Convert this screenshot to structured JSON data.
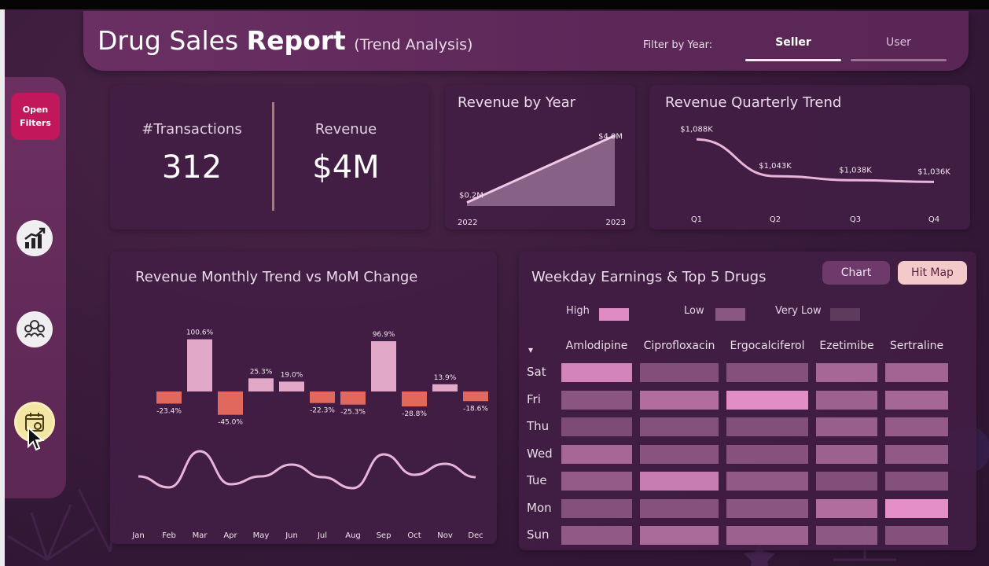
{
  "header": {
    "title_main": "Drug Sales ",
    "title_bold": "Report",
    "title_sub": "(Trend Analysis)",
    "filter_label": "Filter by Year:",
    "tabs": [
      {
        "label": "Seller",
        "active": true
      },
      {
        "label": "User",
        "active": false
      }
    ]
  },
  "sidebar": {
    "open_filters_line1": "Open",
    "open_filters_line2": "Filters",
    "icons": [
      "growth-chart-icon",
      "users-group-icon",
      "calendar-icon"
    ],
    "accent": "#c2185b"
  },
  "kpis": [
    {
      "label": "#Transactions",
      "value": "312"
    },
    {
      "label": "Revenue",
      "value": "$4M"
    }
  ],
  "revenue_by_year": {
    "title": "Revenue by Year",
    "labels": {
      "start": "$0.2M",
      "end": "$4.0M"
    },
    "chart_data": {
      "type": "area",
      "x": [
        "2022",
        "2023"
      ],
      "y": [
        0.2,
        4.0
      ],
      "unit": "$M"
    }
  },
  "revenue_quarterly": {
    "title": "Revenue Quarterly Trend",
    "chart_data": {
      "type": "line",
      "categories": [
        "Q1",
        "Q2",
        "Q3",
        "Q4"
      ],
      "values": [
        1088,
        1043,
        1038,
        1036
      ],
      "data_labels": [
        "$1,088K",
        "$1,043K",
        "$1,038K",
        "$1,036K"
      ],
      "ylim": [
        1020,
        1095
      ]
    }
  },
  "monthly": {
    "title": "Revenue Monthly Trend vs MoM Change",
    "chart_data": {
      "type": "bar",
      "categories": [
        "Jan",
        "Feb",
        "Mar",
        "Apr",
        "May",
        "Jun",
        "Jul",
        "Aug",
        "Sep",
        "Oct",
        "Nov",
        "Dec"
      ],
      "mom_change": [
        null,
        -23.4,
        100.6,
        -45.0,
        25.3,
        19.0,
        -22.3,
        -25.3,
        96.9,
        -28.8,
        13.9,
        -18.6
      ],
      "mom_labels": [
        "",
        "-23.4%",
        "100.6%",
        "-45.0%",
        "25.3%",
        "19.0%",
        "-22.3%",
        "-25.3%",
        "96.9%",
        "-28.8%",
        "13.9%",
        "-18.6%"
      ],
      "revenue_trend": [
        0.58,
        0.44,
        0.9,
        0.48,
        0.58,
        0.73,
        0.57,
        0.43,
        0.86,
        0.6,
        0.74,
        0.57
      ],
      "positive_color": "#e2a8c8",
      "negative_color": "#e0685c",
      "line_color": "#e8b4d8"
    }
  },
  "weekday": {
    "title": "Weekday Earnings & Top 5 Drugs",
    "btn_chart": "Chart",
    "btn_hitmap": "Hit Map",
    "legend": [
      {
        "label": "High",
        "color": "#e08bc4"
      },
      {
        "label": "Low",
        "color": "#8a5682"
      },
      {
        "label": "Very Low",
        "color": "#5e3a5c"
      }
    ],
    "sort_indicator": "▾",
    "chart_data": {
      "type": "heatmap",
      "columns": [
        "Amlodipine",
        "Ciprofloxacin",
        "Ergocalciferol",
        "Ezetimibe",
        "Sertraline"
      ],
      "rows": [
        "Sat",
        "Fri",
        "Thu",
        "Wed",
        "Tue",
        "Mon",
        "Sun"
      ],
      "values": [
        [
          0.88,
          0.28,
          0.3,
          0.55,
          0.52
        ],
        [
          0.35,
          0.62,
          0.98,
          0.48,
          0.55
        ],
        [
          0.25,
          0.3,
          0.28,
          0.45,
          0.42
        ],
        [
          0.55,
          0.33,
          0.32,
          0.48,
          0.4
        ],
        [
          0.42,
          0.8,
          0.4,
          0.28,
          0.3
        ],
        [
          0.3,
          0.32,
          0.35,
          0.62,
          1.0
        ],
        [
          0.4,
          0.58,
          0.48,
          0.38,
          0.3
        ]
      ]
    }
  }
}
